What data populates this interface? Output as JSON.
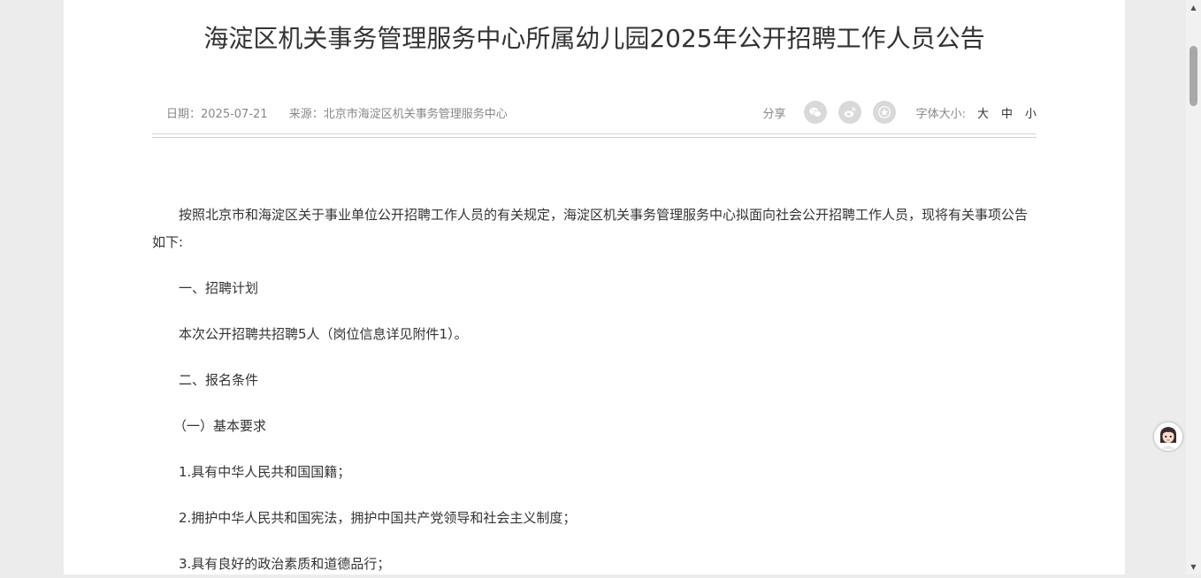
{
  "article": {
    "title": "海淀区机关事务管理服务中心所属幼儿园2025年公开招聘工作人员公告",
    "date_label": "日期：",
    "date": "2025-07-21",
    "source_label": "来源：",
    "source": "北京市海淀区机关事务管理服务中心",
    "share_label": "分享",
    "share_icons": [
      "wechat-icon",
      "weibo-icon",
      "favorite-star-icon"
    ],
    "font_size_label": "字体大小:",
    "font_sizes": [
      "大",
      "中",
      "小"
    ],
    "paragraphs": [
      "按照北京市和海淀区关于事业单位公开招聘工作人员的有关规定，海淀区机关事务管理服务中心拟面向社会公开招聘工作人员，现将有关事项公告如下:",
      "一、招聘计划",
      "本次公开招聘共招聘5人（岗位信息详见附件1）。",
      "二、报名条件",
      "（一）基本要求",
      "1.具有中华人民共和国国籍；",
      "2.拥护中华人民共和国宪法，拥护中国共产党领导和社会主义制度；",
      "3.具有良好的政治素质和道德品行；"
    ]
  },
  "scrollbar": {
    "position_fraction": 0.08
  },
  "colors": {
    "page_bg": "#ececec",
    "content_bg": "#ffffff",
    "text": "#333333",
    "meta": "#888888",
    "icon_bg": "#d9d9d9"
  }
}
